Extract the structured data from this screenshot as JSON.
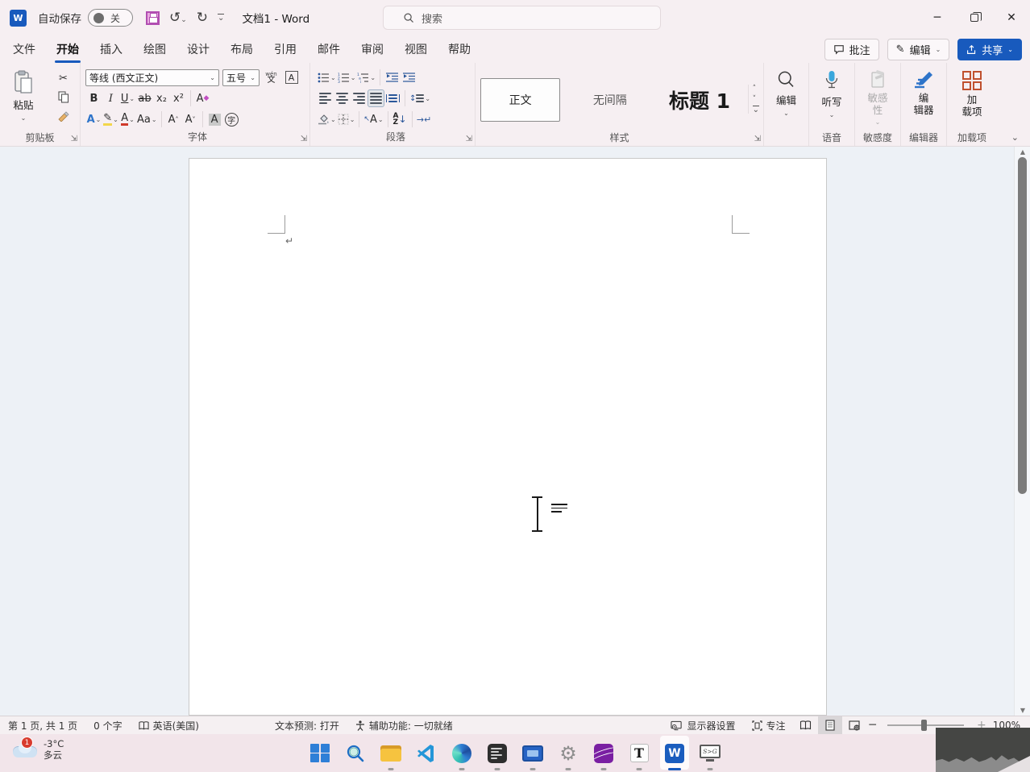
{
  "colors": {
    "accent": "#185abd",
    "chrome_bg": "#f6eff2",
    "doc_bg": "#edf1f6",
    "taskbar_bg": "#f2e5ea",
    "share_button_bg": "#185abd",
    "save_icon": "#b14eb1",
    "badge_red": "#d83b2e"
  },
  "titlebar": {
    "autosave": "自动保存",
    "autosave_state": "关",
    "title": "文档1 - Word",
    "search": "搜索"
  },
  "tabs": [
    "文件",
    "开始",
    "插入",
    "绘图",
    "设计",
    "布局",
    "引用",
    "邮件",
    "审阅",
    "视图",
    "帮助"
  ],
  "actions": {
    "comments": "批注",
    "edit": "编辑",
    "share": "共享"
  },
  "ribbon": {
    "paste": "粘贴",
    "clipboard_label": "剪贴板",
    "font_name": "等线 (西文正文)",
    "font_size": "五号",
    "bold": "B",
    "italic": "I",
    "underline": "U",
    "strike": "ab",
    "subscript": "x₂",
    "superscript": "x²",
    "clear": "A",
    "effects": "A",
    "fontcolor": "A",
    "case": "Aa",
    "grow": "A",
    "shrink": "A",
    "charshade": "A",
    "enclose": "字",
    "pinyin_top": "wén",
    "pinyin_bot": "文",
    "charborder": "A",
    "font_label": "字体",
    "sort_top": "A",
    "sort_bot": "Z",
    "para_label": "段落",
    "styles": [
      "正文",
      "无间隔",
      "标题 1"
    ],
    "styles_label": "样式",
    "edit_btn": "编辑",
    "dictate": "听写",
    "voice_label": "语音",
    "sensitivity": "敏感\n性",
    "sensitivity_label": "敏感度",
    "editor": "编\n辑器",
    "editor_label": "编辑器",
    "addins": "加\n载项",
    "addins_label": "加载项"
  },
  "statusbar": {
    "page": "第 1 页, 共 1 页",
    "words": "0 个字",
    "lang": "英语(美国)",
    "prediction": "文本预测: 打开",
    "accessibility": "辅助功能: 一切就绪",
    "display": "显示器设置",
    "focus": "专注",
    "zoom": "100%"
  },
  "taskbar": {
    "badge": "1",
    "temp": "-3°C",
    "condition": "多云",
    "sg": "S>G"
  }
}
